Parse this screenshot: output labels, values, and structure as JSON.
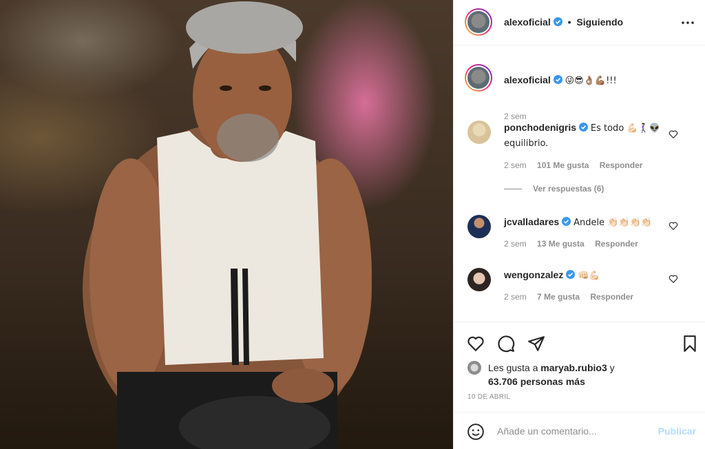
{
  "post": {
    "author": "alexoficial",
    "follow_status": "Siguiendo",
    "separator": "•",
    "caption_emojis": "😜😎👌🏽💪🏽!!!",
    "caption_time": "2 sem",
    "photo_alt": "hombre en camiseta de tirantes blanca"
  },
  "comments": [
    {
      "username": "ponchodenigris",
      "text": "Es todo 💪🏻🚶🏻‍♀️👽equilibrio.",
      "time": "2 sem",
      "likes": "101 Me gusta",
      "reply": "Responder",
      "view_replies": "Ver respuestas (6)"
    },
    {
      "username": "jcvalladares",
      "text": "Andele 👏🏻👏🏻👏🏻👏🏻",
      "time": "2 sem",
      "likes": "13 Me gusta",
      "reply": "Responder"
    },
    {
      "username": "wengonzalez",
      "text": "👊🏻💪🏻",
      "time": "2 sem",
      "likes": "7 Me gusta",
      "reply": "Responder"
    }
  ],
  "likes_block": {
    "prefix": "Les gusta a",
    "liker": "maryab.rubio3",
    "connector": "y",
    "others": "63.706 personas más"
  },
  "date": "10 DE ABRIL",
  "add_comment": {
    "placeholder": "Añade un comentario...",
    "publish_label": "Publicar"
  },
  "colors": {
    "verified_blue": "#3897f0",
    "publish_disabled": "#b3dbff",
    "secondary_text": "#8e8e8e"
  },
  "icons": [
    "more-options-icon",
    "verified-badge-icon",
    "heart-icon",
    "comment-icon",
    "share-icon",
    "bookmark-icon",
    "emoji-icon"
  ]
}
